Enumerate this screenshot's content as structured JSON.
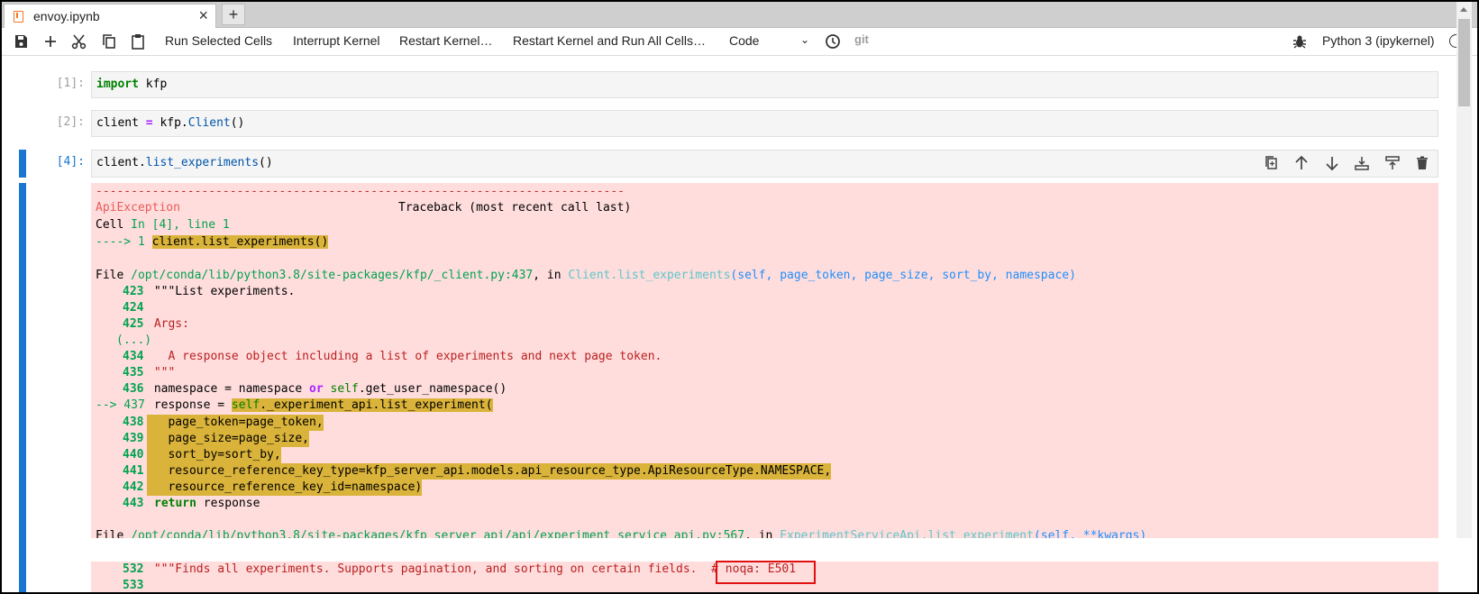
{
  "tab": {
    "title": "envoy.ipynb",
    "close": "×",
    "new_tab": "+"
  },
  "toolbar": {
    "run_selected": "Run Selected Cells",
    "interrupt": "Interrupt Kernel",
    "restart": "Restart Kernel…",
    "restart_run_all": "Restart Kernel and Run All Cells…",
    "cell_type": "Code",
    "git": "git",
    "kernel": "Python 3 (ipykernel)"
  },
  "cells": [
    {
      "prompt": "[1]:",
      "code": {
        "kw": "import",
        "rest": " kfp"
      }
    },
    {
      "prompt": "[2]:",
      "code": {
        "a": "client ",
        "op": "=",
        "b": " kfp.",
        "fn": "Client",
        "c": "()"
      }
    },
    {
      "prompt": "[4]:",
      "code": {
        "a": "client.",
        "fn": "list_experiments",
        "c": "()"
      }
    }
  ],
  "output": {
    "dash_line": "---------------------------------------------------------------------------",
    "exc_name": "ApiException",
    "traceback_hdr": "Traceback (most recent call last)",
    "cell_line": {
      "a": "Cell ",
      "b": "In [4], line 1"
    },
    "arrow1": {
      "a": "----> 1 ",
      "b": "client.list_experiments()"
    },
    "file1": {
      "a": "File ",
      "path": "/opt/conda/lib/python3.8/site-packages/kfp/_client.py:437",
      "b": ", in ",
      "fn": "Client.list_experiments",
      "args": "(self, page_token, page_size, sort_by, namespace)"
    },
    "l423": {
      "n": "423",
      "t": " \"\"\"List experiments."
    },
    "l424": {
      "n": "424",
      "t": ""
    },
    "l425": {
      "n": "425",
      "t": " Args:"
    },
    "ellipsis": "(...)",
    "l434": {
      "n": "434",
      "t": "   A response object including a list of experiments and next page token."
    },
    "l435": {
      "n": "435",
      "t": " \"\"\""
    },
    "l436": {
      "n": "436",
      "a": " namespace = namespace ",
      "or": "or",
      "b": " ",
      "self": "self",
      "c": ".get_user_namespace()"
    },
    "l437": {
      "arrow": "--> 437",
      "a": " response = ",
      "self": "self",
      "c": "._experiment_api.list_experiment("
    },
    "l438": {
      "n": "438",
      "t": "   page_token=page_token,"
    },
    "l439": {
      "n": "439",
      "t": "   page_size=page_size,"
    },
    "l440": {
      "n": "440",
      "t": "   sort_by=sort_by,"
    },
    "l441": {
      "n": "441",
      "t": "   resource_reference_key_type=kfp_server_api.models.api_resource_type.ApiResourceType.NAMESPACE,"
    },
    "l442": {
      "n": "442",
      "t": "   resource_reference_key_id=namespace)"
    },
    "l443": {
      "n": "443",
      "kw": "return",
      "t": " response"
    },
    "file2": {
      "a": "File ",
      "path": "/opt/conda/lib/python3.8/site-packages/kfp_server_api/api/experiment_service_api.py:567",
      "b": ", in ",
      "fn": "ExperimentServiceApi.list_experiment",
      "args": "(self, **kwargs)"
    },
    "l532": {
      "n": "532",
      "t": " \"\"\"Finds all experiments. Supports pagination, and sorting on certain fields.  ",
      "noqa": "# noqa: E501"
    },
    "l533": {
      "n": "533"
    }
  }
}
